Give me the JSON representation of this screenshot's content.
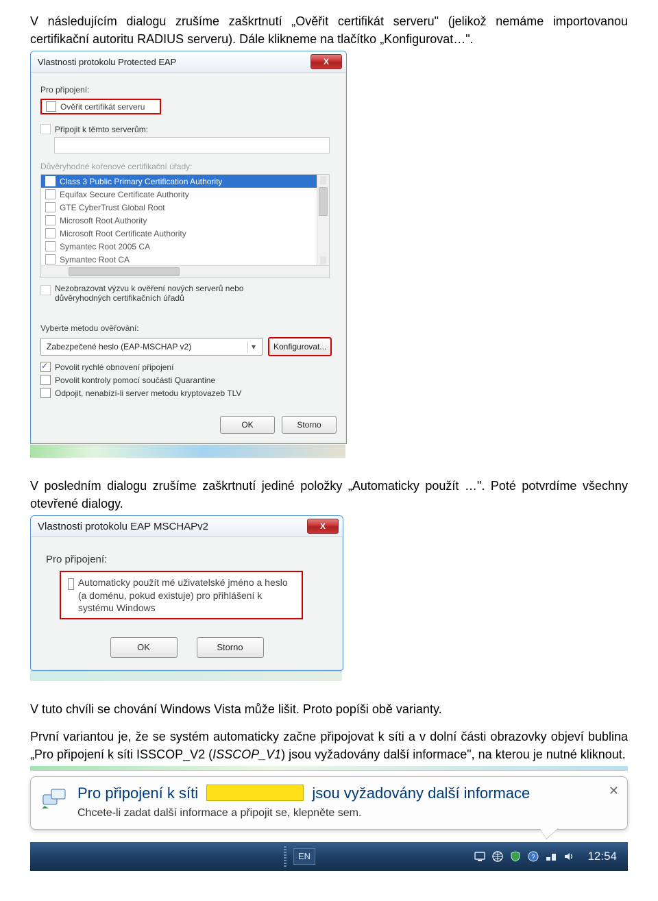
{
  "para1": "V následujícím dialogu zrušíme zaškrtnutí „Ověřit certifikát serveru\" (jelikož nemáme importovanou certifikační autoritu RADIUS serveru). Dále klikneme na tlačítko „Konfigurovat…\".",
  "peap": {
    "title": "Vlastnosti protokolu Protected EAP",
    "pro": "Pro připojení:",
    "verify": "Ověřit certifikát serveru",
    "connect_to": "Připojit k těmto serverům:",
    "trusted_lbl": "Důvěryhodné kořenové certifikační úřady:",
    "list": [
      "Class 3 Public Primary Certification Authority",
      "Equifax Secure Certificate Authority",
      "GTE CyberTrust Global Root",
      "Microsoft Root Authority",
      "Microsoft Root Certificate Authority",
      "Symantec Root 2005 CA",
      "Symantec Root CA"
    ],
    "noprompt1": "Nezobrazovat výzvu k ověření nových serverů nebo",
    "noprompt2": "důvěryhodných certifikačních úřadů",
    "method_lbl": "Vyberte metodu ověřování:",
    "method_val": "Zabezpečené heslo (EAP-MSCHAP v2)",
    "config": "Konfigurovat...",
    "opt1": "Povolit rychlé obnovení připojení",
    "opt2": "Povolit kontroly pomocí součásti Quarantine",
    "opt3": "Odpojit, nenabízí-li server metodu kryptovazeb TLV",
    "ok": "OK",
    "cancel": "Storno"
  },
  "para2": "V posledním dialogu zrušíme zaškrtnutí jediné položky „Automaticky použít …\". Poté potvrdíme všechny otevřené dialogy.",
  "mschap": {
    "title": "Vlastnosti protokolu EAP MSCHAPv2",
    "pro": "Pro připojení:",
    "autotext": "Automaticky použít mé uživatelské jméno a heslo (a doménu, pokud existuje) pro přihlášení k systému Windows",
    "ok": "OK",
    "cancel": "Storno"
  },
  "para3": "V tuto chvíli se chování Windows Vista může lišit. Proto popíši obě varianty.",
  "para4a": "První variantou je, že se systém automaticky začne připojovat k síti a v dolní části obrazovky objeví bublina „Pro připojení k síti ISSCOP_V2 (",
  "para4b": "ISSCOP_V1",
  "para4c": ") jsou vyžadovány další informace\", na kterou je nutné kliknout.",
  "toast": {
    "title_a": "Pro připojení k síti",
    "title_b": "jsou vyžadovány další informace",
    "sub": "Chcete-li zadat další informace a připojit se, klepněte sem."
  },
  "taskbar": {
    "lang": "EN",
    "clock": "12:54"
  }
}
